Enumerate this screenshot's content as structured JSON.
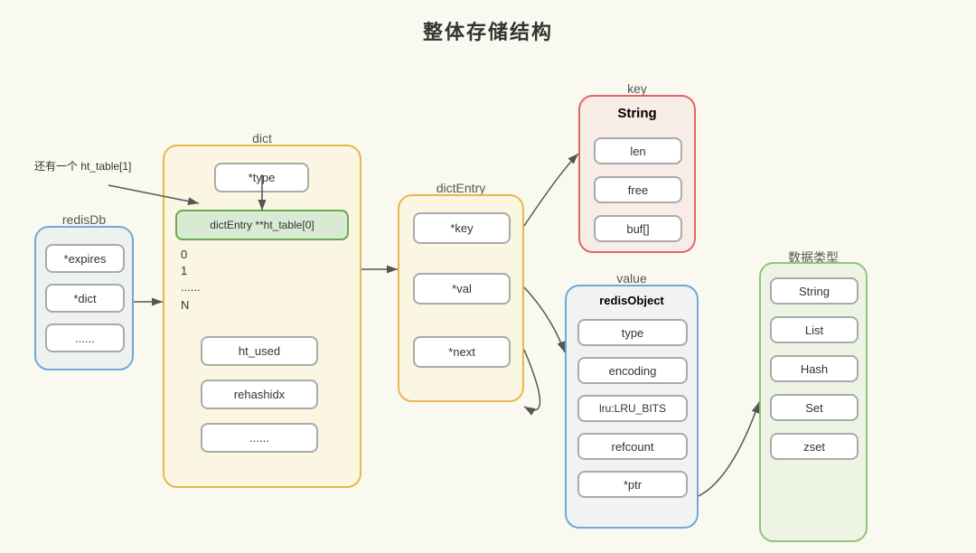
{
  "title": "整体存储结构",
  "labels": {
    "redisDb": "redisDb",
    "dict": "dict",
    "dictEntry": "dictEntry",
    "key": "key",
    "value": "value",
    "dataType": "数据类型",
    "redisObject": "redisObject",
    "stringKey": "String",
    "note": "还有一个\nht_table[1]"
  },
  "redisDbFields": [
    "*expires",
    "*dict",
    "......"
  ],
  "dictFields": {
    "typeBox": "*type",
    "htTable": "dictEntry **ht_table[0]",
    "htRows": [
      "0",
      "1",
      "......",
      "N"
    ],
    "bottomFields": [
      "ht_used",
      "rehashidx",
      "......"
    ]
  },
  "dictEntryFields": [
    "*key",
    "*val",
    "*next"
  ],
  "stringKeyFields": [
    "len",
    "free",
    "buf[]"
  ],
  "redisObjectFields": [
    "type",
    "encoding",
    "lru:LRU_BITS",
    "refcount",
    "*ptr"
  ],
  "dataTypeFields": [
    "String",
    "List",
    "Hash",
    "Set",
    "zset"
  ]
}
